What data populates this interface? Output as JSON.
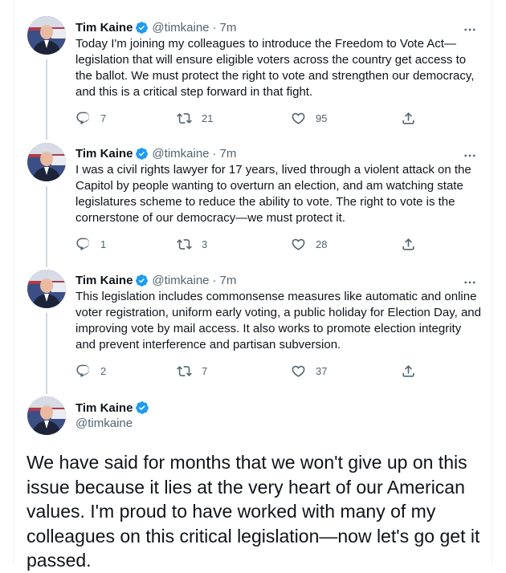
{
  "colors": {
    "verified": "#1d9bf0",
    "secondary_text": "#536471",
    "thread_line": "#cfd9de"
  },
  "tweets": [
    {
      "name": "Tim Kaine",
      "handle": "@timkaine",
      "separator": "·",
      "time": "7m",
      "text": "Today I'm joining my colleagues to introduce the Freedom to Vote Act—legislation that will ensure eligible voters across the country get access to the ballot. We must protect the right to vote and strengthen our democracy, and this is a critical step forward in that fight.",
      "replies": "7",
      "retweets": "21",
      "likes": "95"
    },
    {
      "name": "Tim Kaine",
      "handle": "@timkaine",
      "separator": "·",
      "time": "7m",
      "text": "I was a civil rights lawyer for 17 years, lived through a violent attack on the Capitol by people wanting to overturn an election, and am watching state legislatures scheme to reduce the ability to vote. The right to vote is the cornerstone of our democracy—we must protect it.",
      "replies": "1",
      "retweets": "3",
      "likes": "28"
    },
    {
      "name": "Tim Kaine",
      "handle": "@timkaine",
      "separator": "·",
      "time": "7m",
      "text": "This legislation includes commonsense measures like automatic and online voter registration, uniform early voting, a public holiday for Election Day, and improving vote by mail access. It also works to promote election integrity and prevent interference and partisan subversion.",
      "replies": "2",
      "retweets": "7",
      "likes": "37"
    }
  ],
  "main_tweet": {
    "name": "Tim Kaine",
    "handle": "@timkaine",
    "text": "We have said for months that we won't give up on this issue because it lies at the very heart of our American values. I'm proud to have worked with many of my colleagues on this critical legislation—now let's go get it passed."
  }
}
